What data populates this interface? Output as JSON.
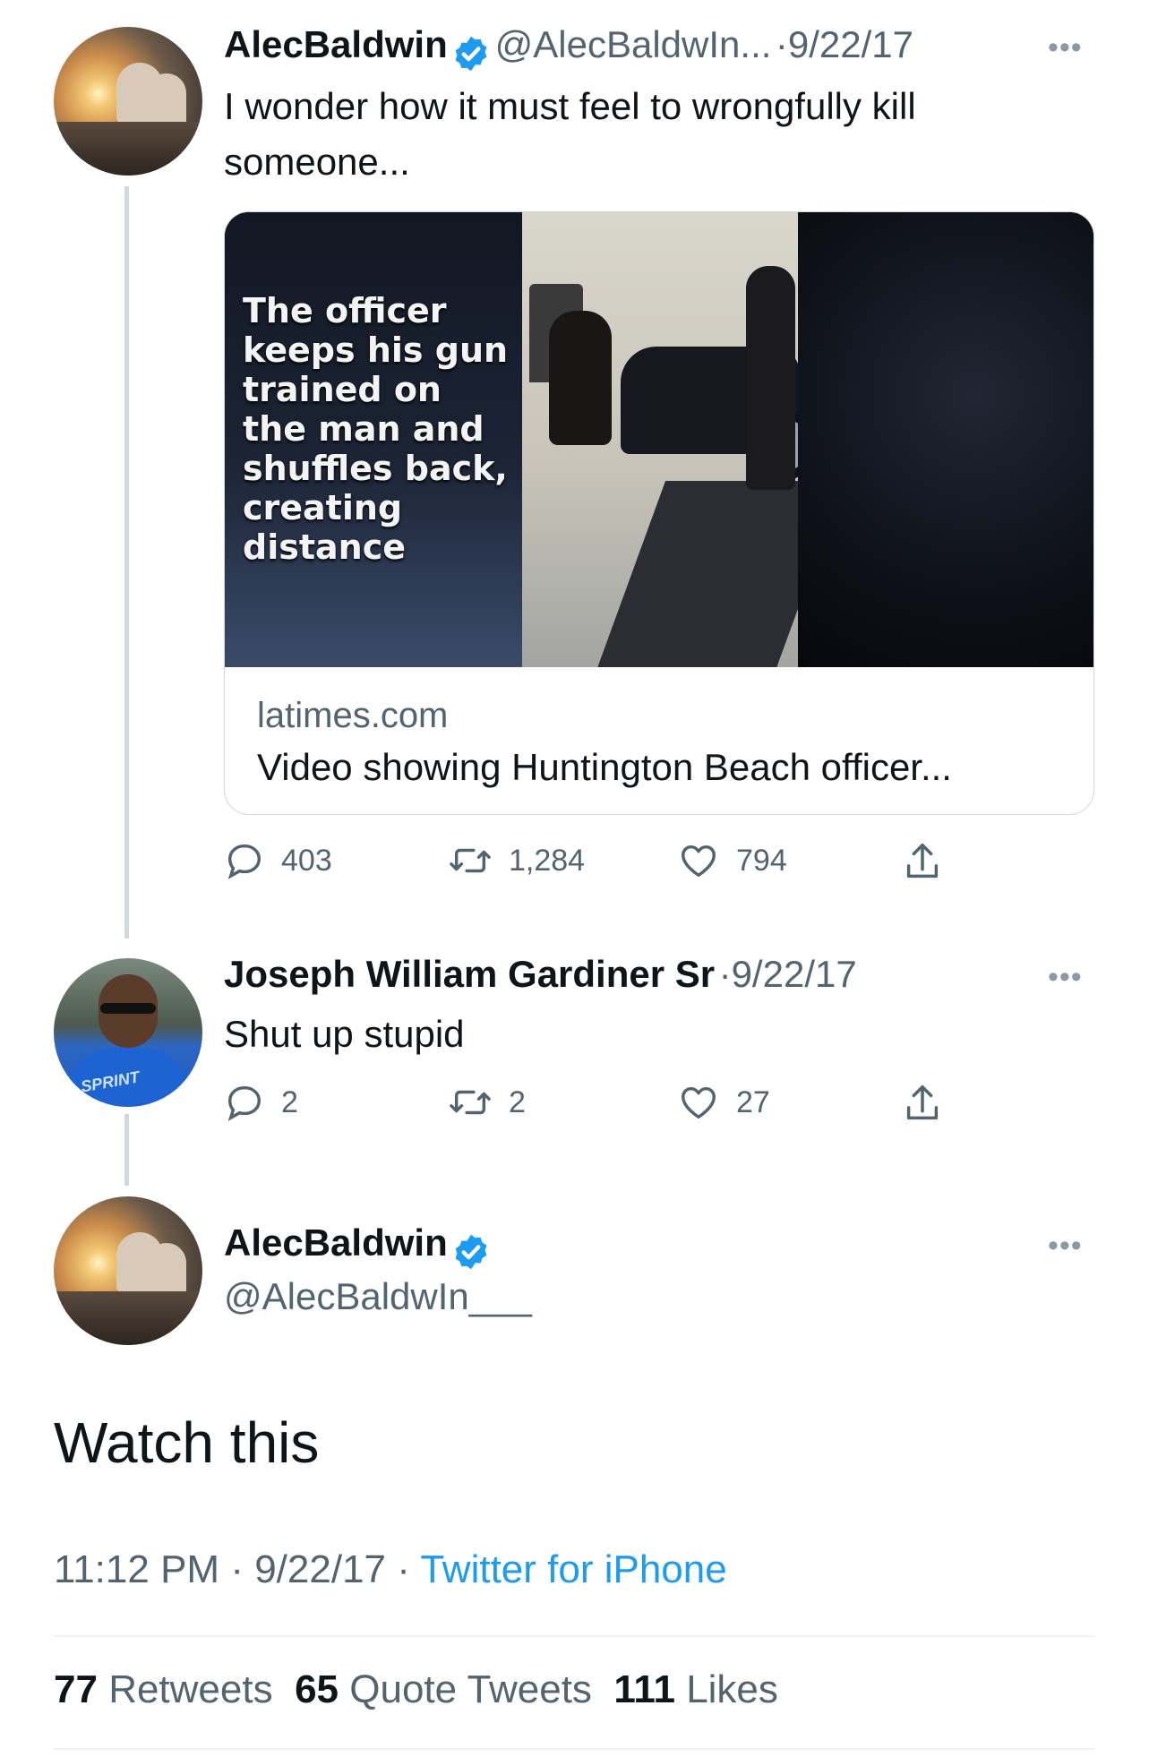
{
  "tweet1": {
    "name": "AlecBaldwin",
    "handle": "@AlecBaldwIn...",
    "separator": "·",
    "date": "9/22/17",
    "text": "I wonder how it must feel to wrongfully kill someone...",
    "card": {
      "image_caption": "The officer keeps his gun trained on the man and shuffles back, creating distance",
      "domain": "latimes.com",
      "title": "Video showing Huntington Beach officer..."
    },
    "actions": {
      "replies": "403",
      "retweets": "1,284",
      "likes": "794"
    }
  },
  "tweet2": {
    "name": "Joseph William Gardiner Sr",
    "separator": "·",
    "date": "9/22/17",
    "text": "Shut up stupid",
    "actions": {
      "replies": "2",
      "retweets": "2",
      "likes": "27"
    }
  },
  "main_tweet": {
    "name": "AlecBaldwin",
    "handle": "@AlecBaldwIn___",
    "text": "Watch this",
    "time": "11:12 PM",
    "separator": "·",
    "date": "9/22/17",
    "source": "Twitter for iPhone",
    "stats": {
      "retweets_count": "77",
      "retweets_label": "Retweets",
      "quotes_count": "65",
      "quotes_label": "Quote Tweets",
      "likes_count": "111",
      "likes_label": "Likes"
    }
  },
  "more_glyph": "•••",
  "colors": {
    "verified": "#1d9bf0",
    "link": "#1d9bf0",
    "muted": "#536471"
  }
}
